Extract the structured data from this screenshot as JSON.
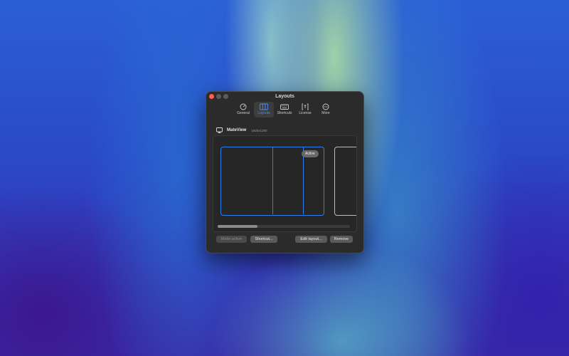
{
  "window": {
    "title": "Layouts"
  },
  "toolbar": {
    "tabs": [
      {
        "label": "General",
        "icon": "gauge-icon"
      },
      {
        "label": "Layouts",
        "icon": "columns-icon"
      },
      {
        "label": "Shortcuts",
        "icon": "keyboard-icon"
      },
      {
        "label": "License",
        "icon": "license-icon"
      },
      {
        "label": "More",
        "icon": "ellipsis-icon"
      }
    ],
    "active_tab": "Layouts"
  },
  "monitor": {
    "name": "MateView",
    "resolution": "1920x1280",
    "icon": "display-icon"
  },
  "layouts": {
    "active_badge": "Active"
  },
  "buttons": {
    "make_active": "Make active",
    "shortcut": "Shortcut...",
    "edit_layout": "Edit layout...",
    "remove": "Remove"
  },
  "colors": {
    "accent": "#2f7cf0",
    "close": "#ff5f57",
    "window_bg": "#2b2b2b"
  }
}
